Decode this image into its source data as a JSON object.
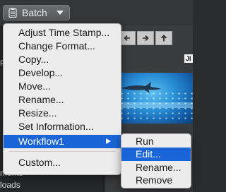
{
  "toolbar": {
    "batch_label": "Batch",
    "batch_icon": "clipboard-list-icon",
    "dropdown_icon": "chevron-down-icon"
  },
  "nav": {
    "back_icon": "arrow-left-icon",
    "forward_icon": "arrow-right-icon",
    "up_icon": "arrow-up-icon"
  },
  "viewer": {
    "badge": "JI"
  },
  "sidebar": {
    "partial_top": "P",
    "partial_ments": "ments",
    "partial_loads": "loads"
  },
  "menu": {
    "items": [
      {
        "label": "Adjust Time Stamp..."
      },
      {
        "label": "Change Format..."
      },
      {
        "label": "Copy..."
      },
      {
        "label": "Develop..."
      },
      {
        "label": "Move..."
      },
      {
        "label": "Rename..."
      },
      {
        "label": "Resize..."
      },
      {
        "label": "Set Information..."
      }
    ],
    "workflow_label": "Workflow1",
    "custom_label": "Custom...",
    "highlight_color": "#1964d7"
  },
  "submenu": {
    "items": [
      {
        "label": "Run"
      },
      {
        "label": "Edit..."
      },
      {
        "label": "Rename..."
      },
      {
        "label": "Remove"
      }
    ]
  }
}
